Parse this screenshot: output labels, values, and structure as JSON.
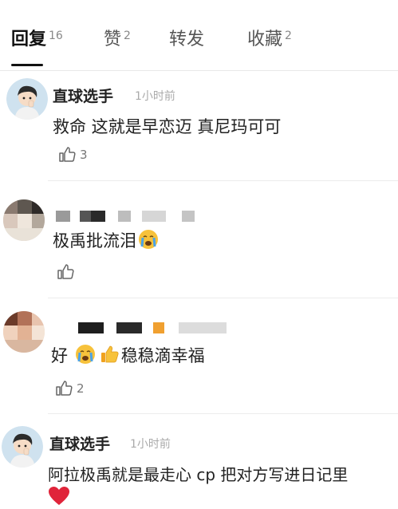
{
  "tabs": [
    {
      "label": "回复",
      "count": "16"
    },
    {
      "label": "赞",
      "count": "2"
    },
    {
      "label": "转发",
      "count": ""
    },
    {
      "label": "收藏",
      "count": "2"
    }
  ],
  "comments": [
    {
      "username": "直球选手",
      "time": "1小时前",
      "text": "救命 这就是早恋迈 真尼玛可可",
      "likes": "3"
    },
    {
      "username": "",
      "time": "",
      "text": "极禹批流泪",
      "likes": ""
    },
    {
      "username": "",
      "time": "",
      "text_before": "好",
      "text_after": "稳稳滴幸福",
      "likes": "2"
    },
    {
      "username": "直球选手",
      "time": "1小时前",
      "text": "阿拉极禹就是最走心 cp 把对方写进日记里",
      "likes": ""
    }
  ],
  "icons": {
    "like": "thumbs-up-icon",
    "cry": "crying-face-emoji",
    "thumb": "thumbs-up-emoji",
    "heart": "red-heart-emoji"
  },
  "colors": {
    "heart": "#e0243a",
    "emoji_yellow": "#f7c23b"
  }
}
